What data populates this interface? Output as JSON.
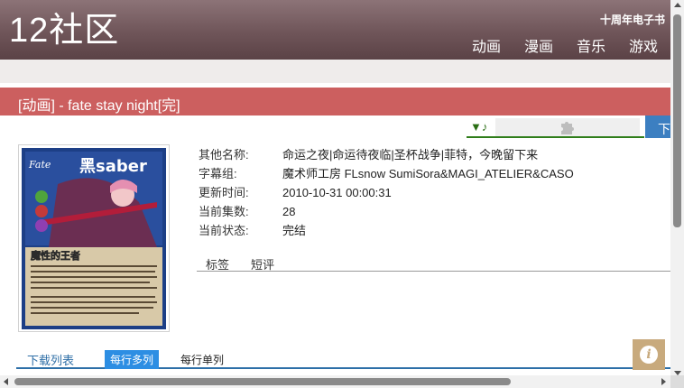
{
  "header": {
    "logo": "12社区",
    "anniversary": "十周年电子书",
    "nav": [
      "动画",
      "漫画",
      "音乐",
      "游戏"
    ]
  },
  "title": "[动画] - fate stay night[完]",
  "player": {
    "note": "▼♪",
    "plugin_icon": "puzzle-icon"
  },
  "download_button": "下",
  "poster": {
    "title_text": "黑saber",
    "logo_text": "Fate",
    "caption": "魔性的王者"
  },
  "info": [
    {
      "key": "其他名称:",
      "value": "命运之夜|命运待夜临|圣杯战争|菲特，今晚留下来"
    },
    {
      "key": "字幕组:",
      "value": "魔术师工房 FLsnow SumiSora&MAGI_ATELIER&CASO"
    },
    {
      "key": "更新时间:",
      "value": "2010-10-31 00:00:31"
    },
    {
      "key": "当前集数:",
      "value": "28"
    },
    {
      "key": "当前状态:",
      "value": "完结"
    }
  ],
  "tabs": [
    "标签",
    "短评"
  ],
  "download_list": {
    "title": "下载列表",
    "multi": "每行多列",
    "single": "每行单列"
  },
  "info_button": "i",
  "colors": {
    "header": "#6f5559",
    "title_bar": "#cc5f5f",
    "accent_blue": "#2d8ee3"
  }
}
